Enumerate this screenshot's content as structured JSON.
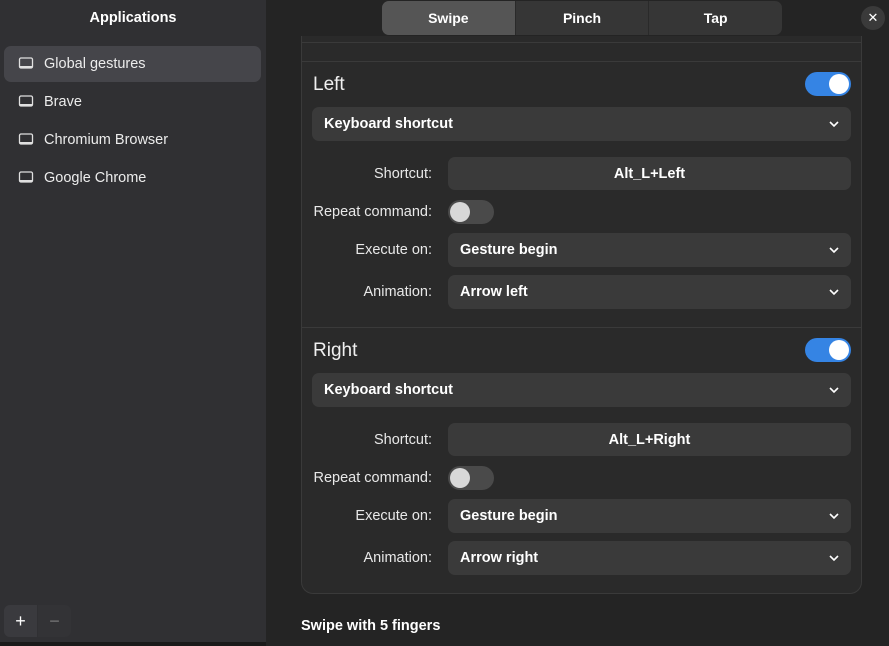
{
  "sidebar": {
    "title": "Applications",
    "items": [
      {
        "label": "Global gestures",
        "icon": "monitor-icon",
        "selected": true
      },
      {
        "label": "Brave",
        "icon": "monitor-icon",
        "selected": false
      },
      {
        "label": "Chromium Browser",
        "icon": "monitor-icon",
        "selected": false
      },
      {
        "label": "Google Chrome",
        "icon": "monitor-icon",
        "selected": false
      }
    ],
    "add_label": "+",
    "remove_label": "−"
  },
  "header": {
    "tabs": [
      {
        "label": "Swipe",
        "active": true
      },
      {
        "label": "Pinch",
        "active": false
      },
      {
        "label": "Tap",
        "active": false
      }
    ],
    "close_label": "✕"
  },
  "sections": [
    {
      "title": "Left",
      "enabled": true,
      "action": "Keyboard shortcut",
      "shortcut_label": "Shortcut:",
      "shortcut_value": "Alt_L+Left",
      "repeat_label": "Repeat command:",
      "repeat_enabled": false,
      "execute_label": "Execute on:",
      "execute_value": "Gesture begin",
      "animation_label": "Animation:",
      "animation_value": "Arrow left"
    },
    {
      "title": "Right",
      "enabled": true,
      "action": "Keyboard shortcut",
      "shortcut_label": "Shortcut:",
      "shortcut_value": "Alt_L+Right",
      "repeat_label": "Repeat command:",
      "repeat_enabled": false,
      "execute_label": "Execute on:",
      "execute_value": "Gesture begin",
      "animation_label": "Animation:",
      "animation_value": "Arrow right"
    }
  ],
  "next_group_title": "Swipe with 5 fingers",
  "colors": {
    "accent": "#3584e4",
    "background": "#242424",
    "sidebar": "#303033"
  }
}
